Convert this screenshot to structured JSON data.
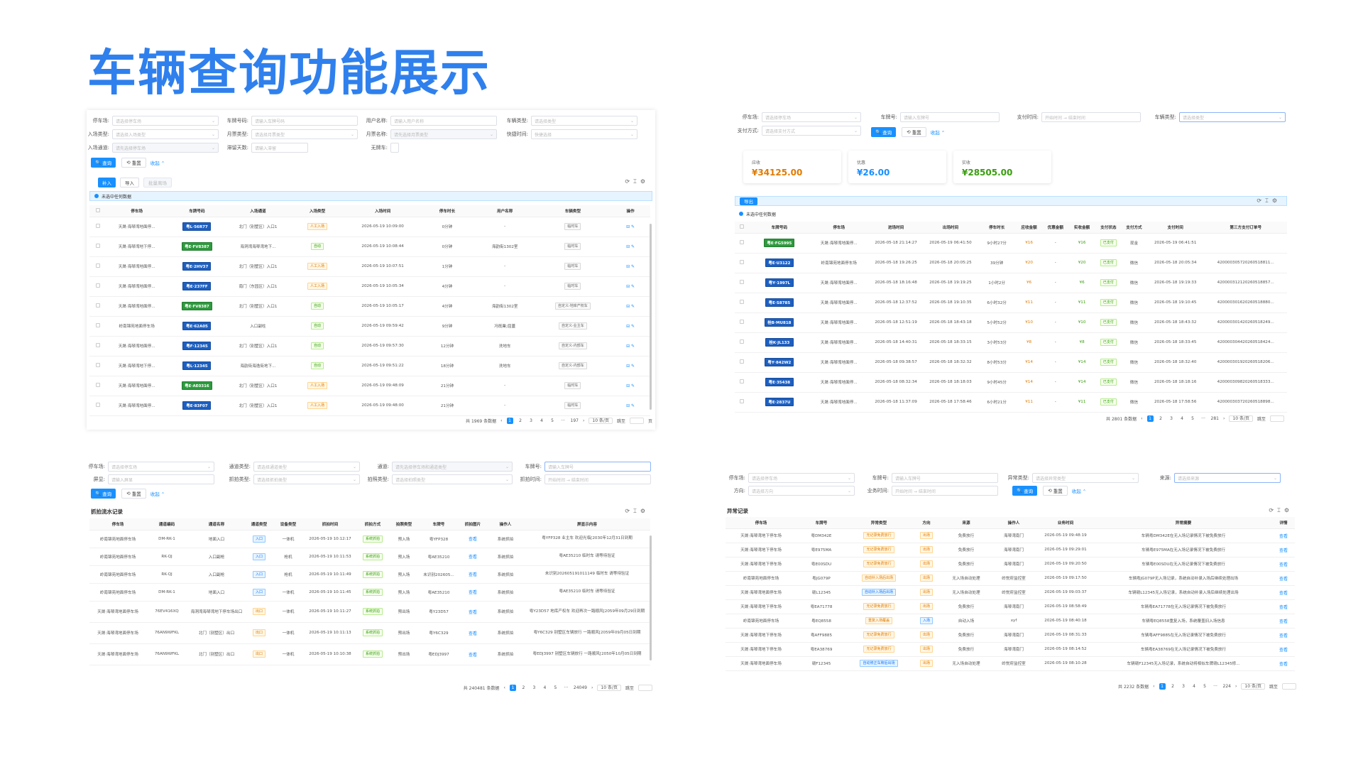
{
  "page_title": "车辆查询功能展示",
  "common": {
    "query": "查询",
    "reset": "重置",
    "collapse": "收起"
  },
  "p1": {
    "filters": [
      {
        "label": "停车场:",
        "ph": "请选择停车场",
        "sel": true
      },
      {
        "label": "车牌号码:",
        "ph": "请输入车牌号码"
      },
      {
        "label": "用户名称:",
        "ph": "请输入用户名称"
      },
      {
        "label": "车辆类型:",
        "ph": "请选择类型",
        "sel": true
      },
      {
        "label": "入场类型:",
        "ph": "请选择入场类型",
        "sel": true
      },
      {
        "label": "月票类型:",
        "ph": "请选择月票类型",
        "sel": true
      },
      {
        "label": "月票名称:",
        "ph": "请先选择月票类型",
        "sel": true,
        "dis": true
      },
      {
        "label": "快捷时间:",
        "ph": "快捷选择",
        "sel": true
      },
      {
        "label": "入场通道:",
        "ph": "请先选择停车场",
        "sel": true,
        "dis": true
      },
      {
        "label": "滞留天数:",
        "ph": "请输入滞留"
      },
      {
        "label": "无牌车:",
        "ph": ""
      }
    ],
    "tabs": [
      "补入",
      "导入",
      "批量离场"
    ],
    "notice": "未选中任何数据",
    "cols": [
      "停车场",
      "车牌号码",
      "入场通道",
      "入场类型",
      "入场时间",
      "停车时长",
      "用户名称",
      "车辆类型",
      "操作"
    ],
    "rows": [
      [
        "天晟·海琴湾地面停...",
        "粤L·56R77",
        "b",
        "北门（别墅区）入口1",
        "人工入场",
        "o",
        "2026-05-19 10:09:00",
        "0分钟",
        "-",
        "临时车"
      ],
      [
        "天晟·海琴湾地下停...",
        "粤E·FV8387",
        "g",
        "海洞湾海琴湾地下...",
        "自动",
        "g",
        "2026-05-19 10:08:44",
        "0分钟",
        "海韵街1302室",
        "临时车"
      ],
      [
        "天晟·海琴湾地面停...",
        "粤E·2HV37",
        "b",
        "北门（别墅区）入口1",
        "人工入场",
        "o",
        "2026-05-19 10:07:51",
        "1分钟",
        "-",
        "临时车"
      ],
      [
        "天晟·海琴湾地面停...",
        "粤E·237FF",
        "b",
        "南门（东园区）入口1",
        "人工入场",
        "o",
        "2026-05-19 10:05:34",
        "4分钟",
        "-",
        "临时车"
      ],
      [
        "天晟·海琴湾地面停...",
        "粤E·FV8387",
        "g",
        "北门（别墅区）入口1",
        "自动",
        "g",
        "2026-05-19 10:05:17",
        "4分钟",
        "海韵街1302室",
        "自定义-地库产权车"
      ],
      [
        "岭南锦苑地面停车场",
        "粤E·62A05",
        "b",
        "入口副柱",
        "自动",
        "g",
        "2026-05-19 09:59:42",
        "9分钟",
        "冯既業;屈蓋",
        "自定义-业主车"
      ],
      [
        "天晟·海琴湾地面停...",
        "粤F·12345",
        "b",
        "北门（别墅区）入口1",
        "自动",
        "g",
        "2026-05-19 09:57:30",
        "12分钟",
        "洗地车",
        "自定义-内部车"
      ],
      [
        "天晟·海琴湾地下停...",
        "粤L·12345",
        "b",
        "海韵街海逸街地下...",
        "自动",
        "g",
        "2026-05-19 09:51:22",
        "18分钟",
        "洗地车",
        "自定义-内部车"
      ],
      [
        "天晟·海琴湾地面停...",
        "粤E·AE0316",
        "g",
        "北门（别墅区）入口1",
        "人工入场",
        "o",
        "2026-05-19 09:48:09",
        "21分钟",
        "-",
        "临时车"
      ],
      [
        "天晟·海琴湾地面停...",
        "粤E·83F07",
        "b",
        "北门（别墅区）入口1",
        "人工入场",
        "o",
        "2026-05-19 09:48:00",
        "21分钟",
        "-",
        "临时车"
      ]
    ],
    "pager": {
      "total": "共 1969 条数据",
      "pages": [
        "1",
        "2",
        "3",
        "4",
        "5",
        "···",
        "197"
      ],
      "size": "10 条/页",
      "jump": "跳至",
      "unit": "页"
    }
  },
  "p2": {
    "filters": [
      {
        "label": "停车场:",
        "ph": "请选择停车场",
        "sel": true
      },
      {
        "label": "车牌号:",
        "ph": "请输入车牌号"
      },
      {
        "label": "支付时间:",
        "ph": "开始时间 → 结束时间"
      },
      {
        "label": "车辆类型:",
        "ph": "请选择类型",
        "sel": true,
        "foc": true
      },
      {
        "label": "支付方式:",
        "ph": "请选择支付方式",
        "sel": true
      }
    ],
    "cards": [
      {
        "label": "应收",
        "value": "¥34125.00",
        "color": "#e07b00"
      },
      {
        "label": "优惠",
        "value": "¥26.00",
        "color": "#1890ff"
      },
      {
        "label": "实收",
        "value": "¥28505.00",
        "color": "#389e0d"
      }
    ],
    "export": "导出",
    "notice": "未选中任何数据",
    "cols": [
      "车牌号码",
      "停车场",
      "进场时间",
      "出场时间",
      "停车时长",
      "应收金额",
      "优惠金额",
      "实收金额",
      "支付状态",
      "支付方式",
      "支付时间",
      "第三方支付订单号"
    ],
    "rows": [
      [
        "粤E·FG5995",
        "g",
        "天晟·海琴湾地面停...",
        "2026-05-18 21:14:27",
        "2026-05-19 06:41:50",
        "9小时27分",
        "¥16",
        "-",
        "¥16",
        "已支付",
        "现金",
        "2026-05-19 06:41:51",
        ""
      ],
      [
        "粤E·U3122",
        "b",
        "岭南锦苑地面停车场",
        "2026-05-18 19:26:25",
        "2026-05-18 20:05:25",
        "39分钟",
        "¥20",
        "-",
        "¥20",
        "已支付",
        "微信",
        "2026-05-18 20:05:34",
        "420000305720260518811..."
      ],
      [
        "粤Y·1997L",
        "b",
        "天晟·海琴湾地面停...",
        "2026-05-18 18:16:48",
        "2026-05-18 19:19:25",
        "1小时2分",
        "¥6",
        "-",
        "¥6",
        "已支付",
        "微信",
        "2026-05-18 19:19:33",
        "420000312120260518857..."
      ],
      [
        "粤E·S8785",
        "b",
        "天晟·海琴湾地面停...",
        "2026-05-18 12:37:52",
        "2026-05-18 19:10:35",
        "6小时32分",
        "¥11",
        "-",
        "¥11",
        "已支付",
        "微信",
        "2026-05-18 19:10:45",
        "420000301620260518880..."
      ],
      [
        "桂B·MU818",
        "b",
        "天晟·海琴湾地面停...",
        "2026-05-18 12:51:19",
        "2026-05-18 18:43:18",
        "5小时52分",
        "¥10",
        "-",
        "¥10",
        "已支付",
        "微信",
        "2026-05-18 18:43:32",
        "420000301420260518249..."
      ],
      [
        "桂K·JL133",
        "b",
        "天晟·海琴湾地面停...",
        "2026-05-18 14:40:31",
        "2026-05-18 18:33:15",
        "3小时53分",
        "¥8",
        "-",
        "¥8",
        "已支付",
        "微信",
        "2026-05-18 18:33:45",
        "420000304420260518424..."
      ],
      [
        "粤Y·842W2",
        "b",
        "天晟·海琴湾地面停...",
        "2026-05-18 09:38:57",
        "2026-05-18 18:32:32",
        "8小时53分",
        "¥14",
        "-",
        "¥14",
        "已支付",
        "微信",
        "2026-05-18 18:32:40",
        "420000301920260518206..."
      ],
      [
        "粤E·35438",
        "b",
        "天晟·海琴湾地面停...",
        "2026-05-18 08:32:34",
        "2026-05-18 18:18:03",
        "9小时45分",
        "¥14",
        "-",
        "¥14",
        "已支付",
        "微信",
        "2026-05-18 18:18:16",
        "420000309820260518333..."
      ],
      [
        "粤E·2837U",
        "b",
        "天晟·海琴湾地面停...",
        "2026-05-18 11:37:09",
        "2026-05-18 17:58:46",
        "6小时21分",
        "¥11",
        "-",
        "¥11",
        "已支付",
        "微信",
        "2026-05-18 17:58:56",
        "420000303720260518898..."
      ]
    ],
    "pager": {
      "total": "共 2801 条数据",
      "pages": [
        "1",
        "2",
        "3",
        "4",
        "5",
        "···",
        "281"
      ],
      "size": "10 条/页",
      "jump": "跳至"
    }
  },
  "p3": {
    "filters": [
      {
        "label": "停车场:",
        "ph": "请选择停车场",
        "sel": true
      },
      {
        "label": "通道类型:",
        "ph": "请选择通道类型",
        "sel": true
      },
      {
        "label": "通道:",
        "ph": "请先选择停车场和通道类型",
        "sel": true,
        "dis": true
      },
      {
        "label": "车牌号:",
        "ph": "请输入车牌号",
        "foc": true
      },
      {
        "label": "屏显:",
        "ph": "请输入屏显"
      },
      {
        "label": "抓拍类型:",
        "ph": "请选择抓拍类型",
        "sel": true
      },
      {
        "label": "拍照类型:",
        "ph": "请选择拍照类型",
        "sel": true
      },
      {
        "label": "抓拍时间:",
        "ph": "开始时间 → 结束时间"
      }
    ],
    "section": "抓拍流水记录",
    "cols": [
      "停车场",
      "通道编码",
      "通道名称",
      "通道类型",
      "设备类型",
      "抓拍时间",
      "抓拍方式",
      "拍照类型",
      "车牌号",
      "抓拍图片",
      "操作人",
      "屏显示内容"
    ],
    "rows": [
      [
        "岭南锦苑地面停车场",
        "DM-RK-1",
        "地面入口",
        "入口",
        "一体机",
        "2026-05-19 10:12:17",
        "系统抓拍",
        "预入场",
        "粤YFP328",
        "查看",
        "系统抓拍",
        "粤YFP328 业主车 欢迎光临[2030年12月31日到期"
      ],
      [
        "岭南锦苑地面停车场",
        "RK-QJ",
        "入口副枪",
        "入口",
        "枪机",
        "2026-05-19 10:11:53",
        "系统抓拍",
        "预入场",
        "粤AE35210",
        "查看",
        "系统抓拍",
        "粤AE35210 临时车 请等待验证"
      ],
      [
        "岭南锦苑地面停车场",
        "RK-QJ",
        "入口副枪",
        "入口",
        "枪机",
        "2026-05-19 10:11:49",
        "系统抓拍",
        "预入场",
        "未识别202605...",
        "查看",
        "系统抓拍",
        "未识别202605191011149 临时车 请等待验证"
      ],
      [
        "岭南锦苑地面停车场",
        "DM-RK-1",
        "地面入口",
        "入口",
        "一体机",
        "2026-05-19 10:11:45",
        "系统抓拍",
        "预入场",
        "粤AE35210",
        "查看",
        "系统抓拍",
        "粤AE35210 临时车 请等待验证"
      ],
      [
        "天晟·海琴湾地面停车场",
        "76EV416XQ",
        "海洞湾海琴湾地下停车场出口",
        "出口",
        "一体机",
        "2026-05-19 10:11:27",
        "系统抓拍",
        "预出场",
        "粤Y23D57",
        "查看",
        "系统抓拍",
        "粤Y23D57 地库产权车 欢迎再次一路顺风[2059年09月29日到期"
      ],
      [
        "天晟·海琴湾地面停车场",
        "76AN9WFKL",
        "北门（别墅区）出口",
        "出口",
        "一体机",
        "2026-05-19 10:11:13",
        "系统抓拍",
        "预出场",
        "粤Y6C329",
        "查看",
        "系统抓拍",
        "粤Y6C329 别墅区车辆放行 一路顺风[2059年09月05日到期"
      ],
      [
        "天晟·海琴湾地面停车场",
        "76AN9WFKL",
        "北门（别墅区）出口",
        "出口",
        "一体机",
        "2026-05-19 10:10:38",
        "系统抓拍",
        "预出场",
        "粤EDJ3997",
        "查看",
        "系统抓拍",
        "粤EDJ3997 别墅区车辆放行 一路顺风[2050年10月05日到期"
      ]
    ],
    "pager": {
      "total": "共 240481 条数据",
      "pages": [
        "1",
        "2",
        "3",
        "4",
        "5",
        "···",
        "24049"
      ],
      "size": "10 条/页",
      "jump": "跳至"
    }
  },
  "p4": {
    "filters": [
      {
        "label": "停车场:",
        "ph": "请选择停车场",
        "sel": true
      },
      {
        "label": "车牌号:",
        "ph": "请输入车牌号"
      },
      {
        "label": "异常类型:",
        "ph": "请选择异常类型",
        "sel": true
      },
      {
        "label": "来源:",
        "ph": "请选择来源",
        "sel": true,
        "foc": true
      },
      {
        "label": "方向:",
        "ph": "请选择方向",
        "sel": true
      },
      {
        "label": "业务时间:",
        "ph": "开始时间 → 结束时间"
      }
    ],
    "section": "异常记录",
    "cols": [
      "停车场",
      "车牌号",
      "异常类型",
      "方向",
      "来源",
      "操作人",
      "业务时间",
      "异常摘要",
      "详情"
    ],
    "rows": [
      [
        "天晟·海琴湾地下停车场",
        "粤DM342E",
        "无记录免费放行",
        "o",
        "出场",
        "o",
        "免费放行",
        "海琴湾南门",
        "2026-05-19 09:48:19",
        "车辆粤DM342E在无入场记录情况下被免费放行"
      ],
      [
        "天晟·海琴湾地下停车场",
        "粤E975MA",
        "无记录免费放行",
        "o",
        "出场",
        "o",
        "免费放行",
        "海琴湾南门",
        "2026-05-19 09:29:01",
        "车辆粤E975MA在无入场记录情况下被免费放行"
      ],
      [
        "天晟·海琴湾地下停车场",
        "粤E00SDU",
        "无记录免费放行",
        "o",
        "出场",
        "o",
        "免费放行",
        "海琴湾南门",
        "2026-05-19 09:20:50",
        "车辆粤E00SDU在无入场记录情况下被免费放行"
      ],
      [
        "岭南锦苑地面停车场",
        "粤JG079P",
        "自动补入场后出场",
        "o",
        "出场",
        "o",
        "无入场自动处理",
        "岭悦府监控室",
        "2026-05-19 09:17:50",
        "车辆粤JG079P无入场记录，系统自动补录入场后继续处理出场"
      ],
      [
        "天晟·海琴湾地面停车场",
        "赣L12345",
        "自动补入场后出场",
        "b",
        "出场",
        "o",
        "无入场自动处理",
        "岭悦府监控室",
        "2026-05-19 09:03:37",
        "车辆赣L12345无入场记录，系统自动补录入场后继续处理出场"
      ],
      [
        "天晟·海琴湾地下停车场",
        "粤EA71778",
        "无记录免费放行",
        "o",
        "出场",
        "o",
        "免费放行",
        "海琴湾南门",
        "2026-05-19 08:58:49",
        "车辆粤EA71778在无入场记录情况下被免费放行"
      ],
      [
        "岭南锦苑地面停车场",
        "粤EQ8558",
        "重复入场覆盖",
        "o",
        "入场",
        "b",
        "自动入场",
        "xyf",
        "2026-05-19 08:40:18",
        "车辆粤EQ8558重复入场，系统覆盖旧入场信息"
      ],
      [
        "天晟·海琴湾地下停车场",
        "粤AFF9885",
        "无记录免费放行",
        "o",
        "出场",
        "o",
        "免费放行",
        "海琴湾南门",
        "2026-05-19 08:31:33",
        "车辆粤AFF9885在无入场记录情况下被免费放行"
      ],
      [
        "天晟·海琴湾地下停车场",
        "粤EA38769",
        "无记录免费放行",
        "o",
        "出场",
        "o",
        "免费放行",
        "海琴湾南门",
        "2026-05-19 08:14:52",
        "车辆粤EA38769在无入场记录情况下被免费放行"
      ],
      [
        "天晟·海琴湾地面停车场",
        "赣F12345",
        "自动修正车牌后出场",
        "b",
        "出场",
        "o",
        "无入场自动处理",
        "岭悦府监控室",
        "2026-05-19 08:10:28",
        "车辆赣F12345无入场记录，系统自动将相似车牌赣L12345修..."
      ]
    ],
    "detail": "查看",
    "pager": {
      "total": "共 2232 条数据",
      "pages": [
        "1",
        "2",
        "3",
        "4",
        "5",
        "···",
        "224"
      ],
      "size": "10 条/页",
      "jump": "跳至"
    }
  },
  "colors": {
    "accent": "#1890ff",
    "title": "#2f80ed"
  }
}
